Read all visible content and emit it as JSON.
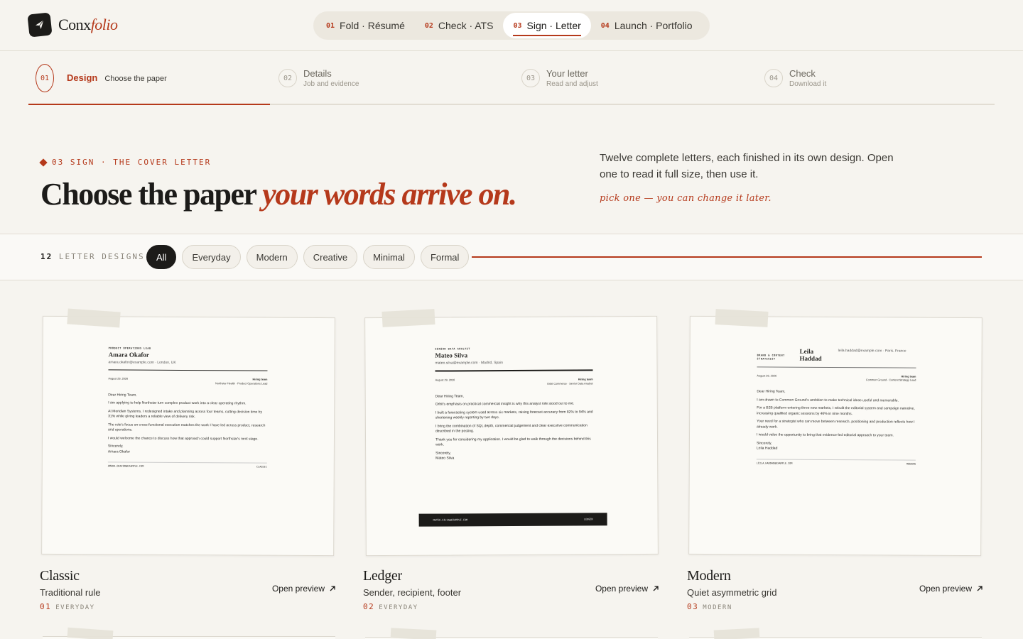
{
  "brand": {
    "name_plain": "Conx",
    "name_italic": "folio"
  },
  "nav": [
    {
      "num": "01",
      "label": "Fold · Résumé"
    },
    {
      "num": "02",
      "label": "Check · ATS"
    },
    {
      "num": "03",
      "label": "Sign · Letter"
    },
    {
      "num": "04",
      "label": "Launch · Portfolio"
    }
  ],
  "steps": [
    {
      "num": "01",
      "title": "Design",
      "sub": "Choose the paper"
    },
    {
      "num": "02",
      "title": "Details",
      "sub": "Job and evidence"
    },
    {
      "num": "03",
      "title": "Your letter",
      "sub": "Read and adjust"
    },
    {
      "num": "04",
      "title": "Check",
      "sub": "Download it"
    }
  ],
  "hero": {
    "eyebrow": "03 SIGN · THE COVER LETTER",
    "title_plain": "Choose the paper",
    "title_italic": "your words arrive on.",
    "desc": "Twelve complete letters, each finished in its own design. Open one to read it full size, then use it.",
    "note": "pick one — you can change it later."
  },
  "filters": {
    "count": "12",
    "count_label": "LETTER DESIGNS",
    "chips": [
      "All",
      "Everyday",
      "Modern",
      "Creative",
      "Minimal",
      "Formal"
    ]
  },
  "cards": [
    {
      "title": "Classic",
      "sub": "Traditional rule",
      "num": "01",
      "tag": "EVERYDAY",
      "open": "Open preview",
      "letter": {
        "role": "PRODUCT OPERATIONS LEAD",
        "name": "Amara Okafor",
        "contact": "amara.okafor@example.com · London, UK",
        "date": "August 29, 2026",
        "to": "Hiring team",
        "to_org": "Northstar Health · Product Operations Lead",
        "greeting": "Dear Hiring Team,",
        "paras": [
          "I am applying to help Northstar turn complex product work into a clear operating rhythm.",
          "At Meridian Systems, I redesigned intake and planning across four teams, cutting decision time by 31% while giving leaders a reliable view of delivery risk.",
          "The role's focus on cross-functional execution matches the work I have led across product, research and operations.",
          "I would welcome the chance to discuss how that approach could support Northstar's next stage."
        ],
        "closing": "Sincerely,",
        "sign": "Amara Okafor",
        "footer_left": "AMARA.OKAFOR@EXAMPLE.COM",
        "footer_right": "CLASSIC"
      }
    },
    {
      "title": "Ledger",
      "sub": "Sender, recipient, footer",
      "num": "02",
      "tag": "EVERYDAY",
      "open": "Open preview",
      "letter": {
        "role": "SENIOR DATA ANALYST",
        "name": "Mateo Silva",
        "contact": "mateo.silva@example.com · Madrid, Spain",
        "date": "August 29, 2026",
        "to": "Hiring team",
        "to_org": "Orbit Commerce · Senior Data Analyst",
        "greeting": "Dear Hiring Team,",
        "paras": [
          "Orbit's emphasis on practical commercial insight is why this analyst role stood out to me.",
          "I built a forecasting system used across six markets, raising forecast accuracy from 82% to 94% and shortening weekly reporting by two days.",
          "I bring the combination of SQL depth, commercial judgement and clear executive communication described in the posting.",
          "Thank you for considering my application. I would be glad to walk through the decisions behind this work."
        ],
        "closing": "Sincerely,",
        "sign": "Mateo Silva",
        "footer_left": "MATEO.SILVA@EXAMPLE.COM",
        "footer_right": "LEDGER"
      }
    },
    {
      "title": "Modern",
      "sub": "Quiet asymmetric grid",
      "num": "03",
      "tag": "MODERN",
      "open": "Open preview",
      "letter": {
        "role": "BRAND & CONTENT STRATEGIST",
        "name": "Leila Haddad",
        "contact": "leila.haddad@example.com · Paris, France",
        "date": "August 29, 2026",
        "to": "Hiring team",
        "to_org": "Common Ground · Content Strategy Lead",
        "greeting": "Dear Hiring Team,",
        "paras": [
          "I am drawn to Common Ground's ambition to make technical ideas useful and memorable.",
          "For a B2B platform entering three new markets, I rebuilt the editorial system and campaign narrative, increasing qualified organic sessions by 46% in nine months.",
          "Your need for a strategist who can move between research, positioning and production reflects how I already work.",
          "I would value the opportunity to bring that evidence-led editorial approach to your team."
        ],
        "closing": "Sincerely,",
        "sign": "Leila Haddad",
        "footer_left": "LEILA.HADDAD@EXAMPLE.COM",
        "footer_right": "MODERN"
      }
    }
  ],
  "colors": {
    "accent": "#b5391b",
    "ink": "#1c1b19",
    "paper": "#f6f4ef"
  }
}
